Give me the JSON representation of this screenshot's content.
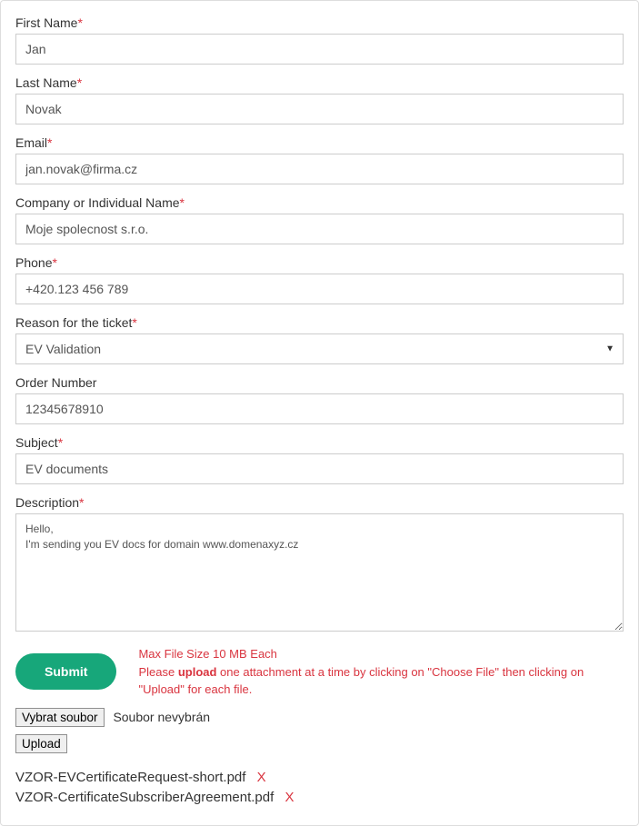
{
  "form": {
    "first_name": {
      "label": "First Name",
      "required": true,
      "value": "Jan"
    },
    "last_name": {
      "label": "Last Name",
      "required": true,
      "value": "Novak"
    },
    "email": {
      "label": "Email",
      "required": true,
      "value": "jan.novak@firma.cz"
    },
    "company": {
      "label": "Company or Individual Name",
      "required": true,
      "value": "Moje spolecnost s.r.o."
    },
    "phone": {
      "label": "Phone",
      "required": true,
      "value": "+420.123 456 789"
    },
    "reason": {
      "label": "Reason for the ticket",
      "required": true,
      "selected": "EV Validation"
    },
    "order_number": {
      "label": "Order Number",
      "required": false,
      "value": "12345678910"
    },
    "subject": {
      "label": "Subject",
      "required": true,
      "value": "EV documents"
    },
    "description": {
      "label": "Description",
      "required": true,
      "value": "Hello,\nI'm sending you EV docs for domain www.domenaxyz.cz"
    }
  },
  "actions": {
    "submit_label": "Submit",
    "choose_file_label": "Vybrat soubor",
    "file_status": "Soubor nevybrán",
    "upload_label": "Upload"
  },
  "upload_note": {
    "line1": "Max File Size 10 MB Each",
    "line2_pre": "Please ",
    "line2_bold": "upload",
    "line2_post": " one attachment at a time by clicking on \"Choose File\" then clicking on \"Upload\" for each file."
  },
  "uploaded_files": [
    {
      "name": "VZOR-EVCertificateRequest-short.pdf"
    },
    {
      "name": "VZOR-CertificateSubscriberAgreement.pdf"
    }
  ],
  "required_marker": "*",
  "remove_marker": "X"
}
